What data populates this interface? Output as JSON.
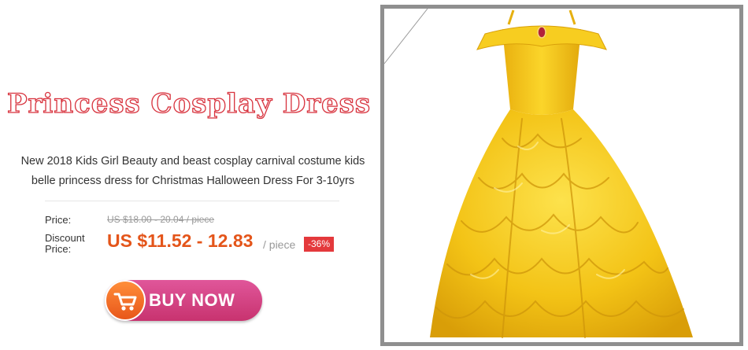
{
  "banner": {
    "title": "Princess Cosplay Dress",
    "description_line1": "New 2018 Kids Girl Beauty and beast cosplay carnival costume kids",
    "description_line2": "belle princess dress for Christmas Halloween Dress For 3-10yrs"
  },
  "pricing": {
    "price_label": "Price:",
    "original_price": "US $18.00 - 20.04 / piece",
    "discount_label_line1": "Discount",
    "discount_label_line2": "Price:",
    "discount_price": "US $11.52 - 12.83",
    "unit": "/ piece",
    "discount_badge": "-36%"
  },
  "cta": {
    "buy_label": "BUY NOW",
    "icon": "shopping-cart-icon"
  },
  "product_image": {
    "subject": "yellow-ball-gown",
    "colors": {
      "gown": "#f5c816",
      "frame": "#8f8f8f",
      "gem": "#b2223a"
    }
  },
  "colors": {
    "title_outline": "#d8343f",
    "price_orange": "#e4551a",
    "badge_red": "#e4393c",
    "button_pink": "#d0407f",
    "button_orange": "#f07a2a"
  }
}
